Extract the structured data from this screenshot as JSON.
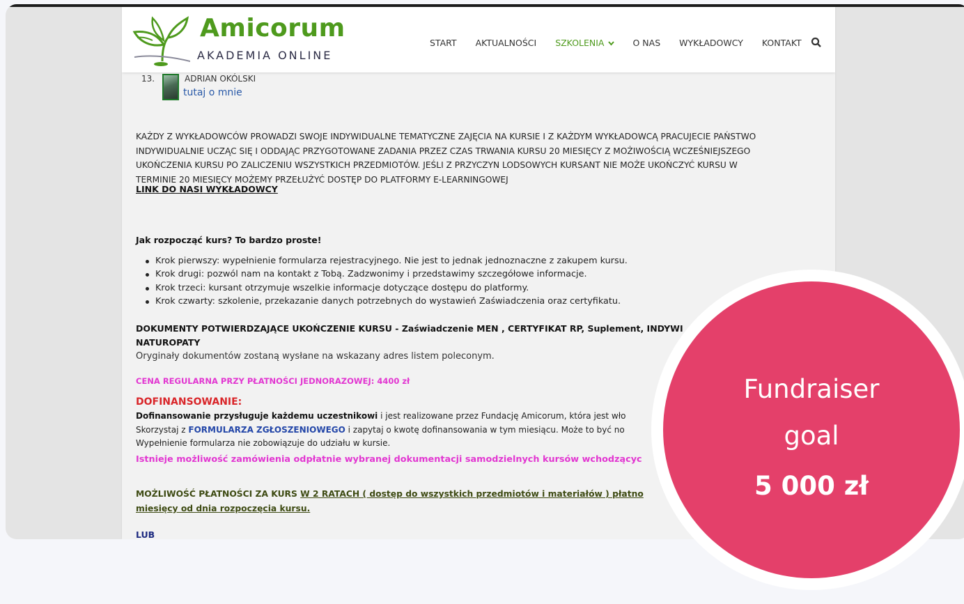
{
  "logo": {
    "name": "Amicorum",
    "subtitle": "AKADEMIA ONLINE"
  },
  "nav": {
    "items": [
      "START",
      "AKTUALNOŚCI",
      "SZKOLENIA",
      "O NAS",
      "WYKŁADOWCY",
      "KONTAKT"
    ],
    "active": "SZKOLENIA"
  },
  "lecturer": {
    "number": "13.",
    "name": "ADRIAN OKÓLSKI",
    "link": "tutaj o mnie"
  },
  "intro": {
    "line1": "KAŻDY Z WYKŁADOWCÓW PROWADZI SWOJE INDYWIDUALNE TEMATYCZNE ZAJĘCIA NA KURSIE I Z KAŻDYM WYKŁADOWCĄ PRACUJECIE PAŃSTWO",
    "line2": "INDYWIDUALNIE UCZĄC SIĘ I ODDAJĄC PRZYGOTOWANE ZADANIA PRZEZ CZAS TRWANIA KURSU 20 MIESIĘCY Z MOŻIWOŚCIĄ WCZEŚNIEJSZEGO",
    "line3": "UKOŃCZENIA KURSU PO ZALICZENIU WSZYSTKICH PRZEDMIOTÓW. JEŚLI Z PRZYCZYN LODSOWYCH KURSANT NIE MOŻE UKOŃCZYĆ KURSU W",
    "line4": "TERMINIE 20 MIESIĘCY MOŻEMY PRZEŁUŻYĆ DOSTĘP DO PLATFORMY E-LEARNINGOWEJ"
  },
  "lecturers_link": "LINK DO NASI WYKŁADOWCY",
  "start_heading": "Jak rozpocząć kurs? To bardzo proste!",
  "steps": [
    "Krok pierwszy: wypełnienie formularza rejestracyjnego. Nie jest to jednak jednoznaczne z zakupem kursu.",
    "Krok drugi: pozwól nam na kontakt z Tobą. Zadzwonimy i przedstawimy szczegółowe informacje.",
    "Krok trzeci: kursant otrzymuje wszelkie informacje dotyczące dostępu do platformy.",
    "Krok czwarty: szkolenie, przekazanie danych potrzebnych do wystawień Zaświadczenia oraz certyfikatu."
  ],
  "docs": {
    "title1": "DOKUMENTY POTWIERDZAJĄCE UKOŃCZENIE KURSU - Zaświadczenie MEN  , CERTYFIKAT RP, Suplement, INDYWI",
    "title2": "NATUROPATY",
    "text": "Oryginały dokumentów zostaną wysłane na wskazany adres listem poleconym."
  },
  "price": "CENA REGULARNA PRZY PŁATNOŚCI  JEDNORAZOWEJ: 4400 zł",
  "dofinansowanie": {
    "title": "DOFINANSOWANIE:",
    "bold": "Dofinansowanie przysługuje każdemu uczestnikowi",
    "rest1": " i jest realizowane przez Fundację Amicorum, która jest wło",
    "pre2": "Skorzystaj z  ",
    "form_link": "FORMULARZA ZGŁOSZENIOWEGO",
    "rest2": " i zapytaj o kwotę dofinansowania w tym miesiącu. Może to być no",
    "line3": "Wypełnienie formularza nie zobowiązuje do udziału w kursie."
  },
  "magenta_line": "Istnieje możliwość zamówienia odpłatnie wybranej dokumentacji samodzielnych kursów wchodzącyc",
  "raty": {
    "pre": "MOŻLIWOŚĆ PŁATNOŚCI ZA KURS ",
    "underlined": "W  2 RATACH  ( dostęp do wszystkich przedmiotów i materiałów ) płatno",
    "line2": "miesięcy od dnia rozpoczęcia kursu."
  },
  "lub": "LUB",
  "badge": {
    "line1": "Fundraiser",
    "line2": "goal",
    "amount": "5 000 zł"
  },
  "colors": {
    "brand_green": "#4e9a1d",
    "badge_pink": "#e4406a",
    "magenta": "#e236d1",
    "red": "#d9262a"
  }
}
